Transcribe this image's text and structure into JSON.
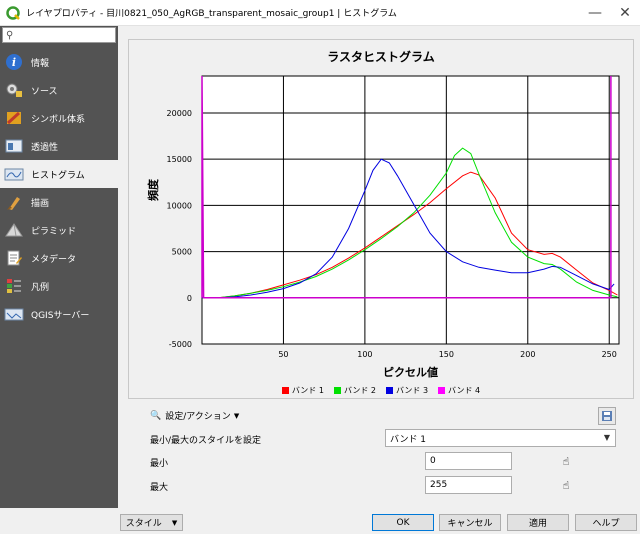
{
  "window": {
    "title": "レイヤプロパティ - 目川0821_050_AgRGB_transparent_mosaic_group1 | ヒストグラム",
    "minimize": "—",
    "close": "✕"
  },
  "sidebar": {
    "search_placeholder": "",
    "items": [
      {
        "label": "情報",
        "icon": "info-icon"
      },
      {
        "label": "ソース",
        "icon": "source-icon"
      },
      {
        "label": "シンボル体系",
        "icon": "symbology-icon"
      },
      {
        "label": "透過性",
        "icon": "transparency-icon"
      },
      {
        "label": "ヒストグラム",
        "icon": "histogram-icon",
        "active": true
      },
      {
        "label": "描画",
        "icon": "render-icon"
      },
      {
        "label": "ピラミッド",
        "icon": "pyramid-icon"
      },
      {
        "label": "メタデータ",
        "icon": "metadata-icon"
      },
      {
        "label": "凡例",
        "icon": "legend-icon"
      },
      {
        "label": "QGISサーバー",
        "icon": "server-icon"
      }
    ]
  },
  "histogram": {
    "settings_label": "設定/アクション",
    "minmax_style_label": "最小/最大のスタイルを設定",
    "minmax_style_value": "バンド 1",
    "min_label": "最小",
    "min_value": "0",
    "max_label": "最大",
    "max_value": "255"
  },
  "chart_data": {
    "type": "line",
    "title": "ラスタヒストグラム",
    "xlabel": "ピクセル値",
    "ylabel": "頻度",
    "xlim": [
      0,
      256
    ],
    "ylim": [
      -5000,
      24000
    ],
    "xticks": [
      50,
      100,
      150,
      200,
      250
    ],
    "yticks": [
      -5000,
      0,
      5000,
      10000,
      15000,
      20000
    ],
    "grid": true,
    "legend_position": "bottom",
    "series": [
      {
        "name": "バンド 1",
        "color": "#ff0000",
        "x": [
          0,
          10,
          20,
          30,
          40,
          50,
          60,
          70,
          80,
          90,
          100,
          110,
          120,
          130,
          140,
          150,
          160,
          165,
          170,
          180,
          190,
          200,
          210,
          215,
          220,
          230,
          240,
          250,
          255
        ],
        "y": [
          0,
          0,
          200,
          500,
          900,
          1400,
          1900,
          2500,
          3300,
          4300,
          5400,
          6600,
          7800,
          9000,
          10300,
          11800,
          13200,
          13600,
          13300,
          10800,
          7000,
          5200,
          4700,
          4800,
          4400,
          3000,
          1600,
          800,
          300
        ]
      },
      {
        "name": "バンド 2",
        "color": "#00e000",
        "x": [
          0,
          10,
          20,
          30,
          40,
          50,
          60,
          70,
          80,
          90,
          100,
          110,
          120,
          130,
          140,
          150,
          155,
          160,
          165,
          170,
          180,
          190,
          200,
          210,
          215,
          220,
          230,
          240,
          250,
          255
        ],
        "y": [
          0,
          0,
          200,
          500,
          800,
          1200,
          1700,
          2300,
          3100,
          4100,
          5200,
          6400,
          7700,
          9200,
          11100,
          13500,
          15400,
          16200,
          15600,
          13400,
          9200,
          6000,
          4400,
          3700,
          3600,
          3100,
          1700,
          800,
          300,
          100
        ]
      },
      {
        "name": "バンド 3",
        "color": "#0000e0",
        "x": [
          0,
          10,
          20,
          30,
          40,
          50,
          60,
          70,
          80,
          90,
          100,
          105,
          110,
          115,
          120,
          130,
          140,
          150,
          160,
          170,
          180,
          190,
          200,
          210,
          215,
          220,
          230,
          240,
          250,
          253
        ],
        "y": [
          0,
          0,
          100,
          300,
          600,
          1000,
          1600,
          2600,
          4400,
          7500,
          11600,
          13800,
          15000,
          14600,
          13200,
          10100,
          7000,
          5000,
          3900,
          3300,
          3000,
          2700,
          2700,
          3100,
          3400,
          3300,
          2400,
          1500,
          900,
          1500
        ]
      },
      {
        "name": "バンド 4",
        "color": "#cc00cc",
        "x": [
          0,
          0.01,
          1,
          250,
          251,
          251.01
        ],
        "y": [
          0,
          24000,
          0,
          0,
          0,
          24000
        ]
      }
    ]
  },
  "buttons": {
    "style": "スタイル",
    "ok": "OK",
    "cancel": "キャンセル",
    "apply": "適用",
    "help": "ヘルプ"
  }
}
